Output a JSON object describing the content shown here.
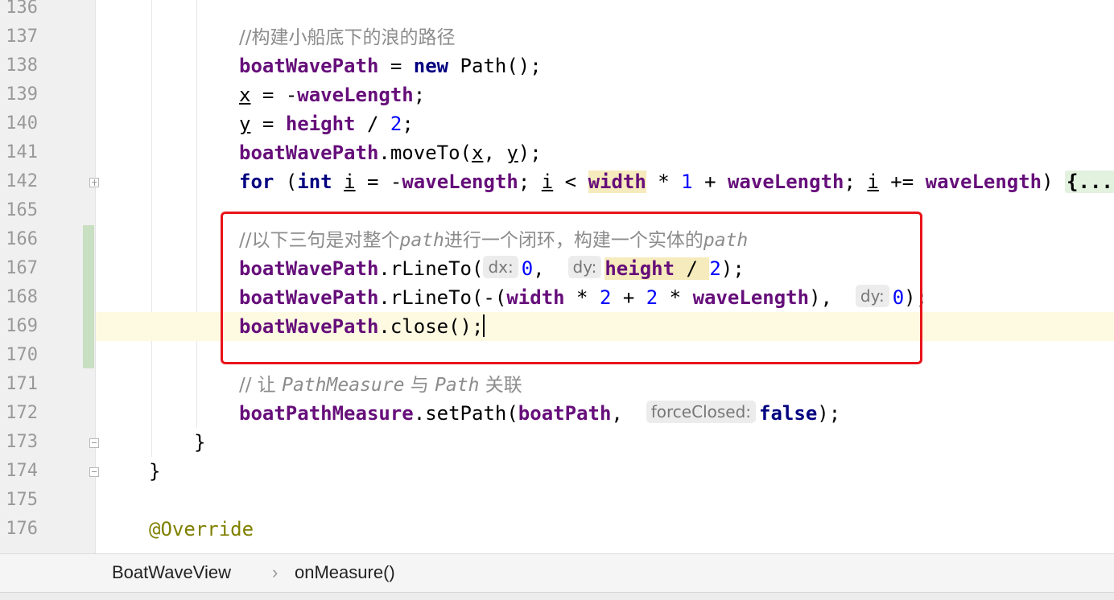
{
  "editor": {
    "lines": {
      "l136": "136",
      "l137": "137",
      "l138": "138",
      "l139": "139",
      "l140": "140",
      "l141": "141",
      "l142": "142",
      "l165": "165",
      "l166": "166",
      "l167": "167",
      "l168": "168",
      "l169": "169",
      "l170": "170",
      "l171": "171",
      "l172": "172",
      "l173": "173",
      "l174": "174",
      "l175": "175",
      "l176": "176"
    },
    "tokens": {
      "comment_137": "//构建小船底下的浪的路径",
      "boatWavePath": "boatWavePath",
      "eq_new": " = ",
      "new_kw": "new",
      "path_ctor": " Path();",
      "x": "x",
      "assign": " = ",
      "minus": "-",
      "waveLength": "waveLength",
      "semi": ";",
      "y": "y",
      "height": "height",
      "div": " / ",
      "two": "2",
      "moveTo_open": ".moveTo(",
      "comma_sp": ", ",
      "close_paren_semi": ");",
      "for_kw": "for",
      "paren_open": " (",
      "int_kw": "int",
      "space": " ",
      "i": "i",
      "lt": " < ",
      "width": "width",
      "times": " * ",
      "one": "1",
      "plus": " + ",
      "semi_sp": "; ",
      "plus_eq": " += ",
      "paren_close_sp": ") ",
      "fold_body": "{...}",
      "comment_166_a": "//以下三句是对整个",
      "comment_166_path1": "path",
      "comment_166_b": "进行一个闭环，构建一个实体的",
      "comment_166_path2": "path",
      "rLineTo_open": ".rLineTo(",
      "hint_dx": "dx:",
      "zero": "0",
      "comma_sp2": ",  ",
      "hint_dy": "dy:",
      "rLineTo_neg_open": ".rLineTo(-(",
      "paren_close_comma": "),  ",
      "close_call": ".close();",
      "comment_171_a": "// 让 ",
      "comment_171_pm": "PathMeasure",
      "comment_171_b": " 与 ",
      "comment_171_path": "Path",
      "comment_171_c": " 关联",
      "boatPathMeasure": "boatPathMeasure",
      "setPath_open": ".setPath(",
      "boatPath": "boatPath",
      "hint_forceClosed": "forceClosed:",
      "false_kw": "false",
      "close_brace": "}",
      "override": "@Override"
    }
  },
  "breadcrumb": {
    "class_name": "BoatWaveView",
    "separator": "›",
    "method_name": "onMeasure()"
  }
}
